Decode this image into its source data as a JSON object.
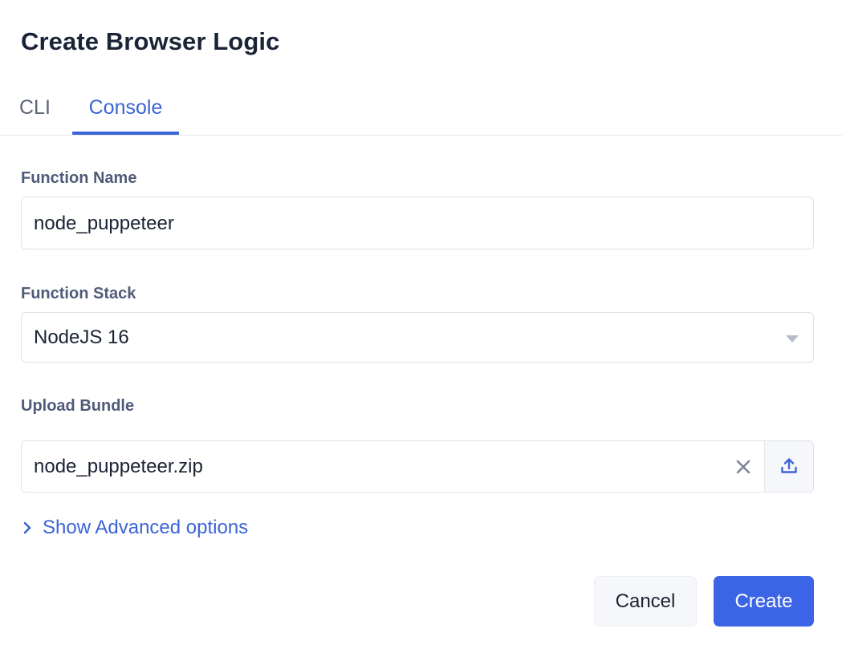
{
  "dialog": {
    "title": "Create Browser Logic"
  },
  "tabs": [
    {
      "label": "CLI",
      "active": false
    },
    {
      "label": "Console",
      "active": true
    }
  ],
  "form": {
    "function_name": {
      "label": "Function Name",
      "value": "node_puppeteer"
    },
    "function_stack": {
      "label": "Function Stack",
      "selected": "NodeJS 16"
    },
    "upload_bundle": {
      "label": "Upload Bundle",
      "file_name": "node_puppeteer.zip"
    },
    "advanced_toggle": "Show Advanced options"
  },
  "actions": {
    "cancel_label": "Cancel",
    "create_label": "Create"
  },
  "icons": {
    "clear": "close-icon",
    "upload": "upload-icon",
    "chevron": "chevron-right-icon",
    "dropdown": "caret-down-icon"
  },
  "colors": {
    "accent": "#3b64e6",
    "label": "#4f5b78",
    "title": "#1b2437"
  }
}
